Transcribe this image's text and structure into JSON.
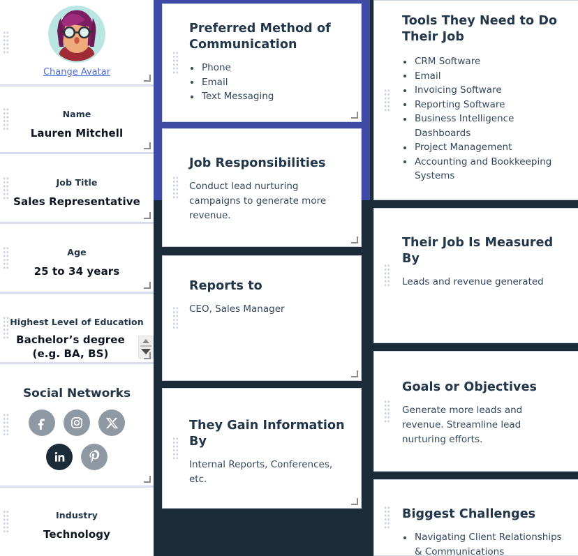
{
  "theme": {
    "page_background": "#1c2b38",
    "card_background": "#ffffff",
    "accent_border": "#3e4aa3",
    "divider": "#d8dcee",
    "heading_color": "#22364a",
    "body_color": "#33475f",
    "link_color": "#4e6ddb",
    "social_inactive": "#8e99a4",
    "social_active": "#1c2b38"
  },
  "left_column": {
    "avatar": {
      "alt": "avatar-illustration-woman-with-glasses",
      "change_link": "Change Avatar"
    },
    "fields": [
      {
        "label": "Name",
        "value": "Lauren Mitchell"
      },
      {
        "label": "Job Title",
        "value": "Sales Representative"
      },
      {
        "label": "Age",
        "value": "25 to 34 years"
      },
      {
        "label": "Highest Level of Education",
        "value": "Bachelor’s degree (e.g. BA, BS)"
      },
      {
        "label": "Industry",
        "value": "Technology"
      }
    ],
    "social": {
      "title": "Social Networks",
      "networks": [
        {
          "name": "facebook",
          "icon": "facebook-icon",
          "active": false
        },
        {
          "name": "instagram",
          "icon": "instagram-icon",
          "active": false
        },
        {
          "name": "x-twitter",
          "icon": "x-twitter-icon",
          "active": false
        },
        {
          "name": "linkedin",
          "icon": "linkedin-icon",
          "active": true
        },
        {
          "name": "pinterest",
          "icon": "pinterest-icon",
          "active": false
        }
      ]
    }
  },
  "middle_column": {
    "cards": [
      {
        "title": "Preferred Method of Communication",
        "type": "list",
        "items": [
          "Phone",
          "Email",
          "Text Messaging"
        ]
      },
      {
        "title": "Job Responsibilities",
        "type": "text",
        "text": "Conduct lead nurturing campaigns to generate more revenue."
      },
      {
        "title": "Reports to",
        "type": "text",
        "text": "CEO, Sales Manager"
      },
      {
        "title": "They Gain Information By",
        "type": "text",
        "text": "Internal Reports, Conferences, etc."
      }
    ]
  },
  "right_column": {
    "cards": [
      {
        "title": "Tools They Need to Do Their Job",
        "type": "list",
        "items": [
          "CRM Software",
          "Email",
          "Invoicing Software",
          "Reporting Software",
          "Business Intelligence Dashboards",
          "Project Management",
          "Accounting and Bookkeeping Systems"
        ]
      },
      {
        "title": "Their Job Is Measured By",
        "type": "text",
        "text": "Leads and revenue generated"
      },
      {
        "title": "Goals or Objectives",
        "type": "text",
        "text": "Generate more leads and revenue. Streamline lead nurturing efforts."
      },
      {
        "title": "Biggest Challenges",
        "type": "list",
        "items": [
          "Navigating Client Relationships & Communications"
        ]
      }
    ]
  }
}
